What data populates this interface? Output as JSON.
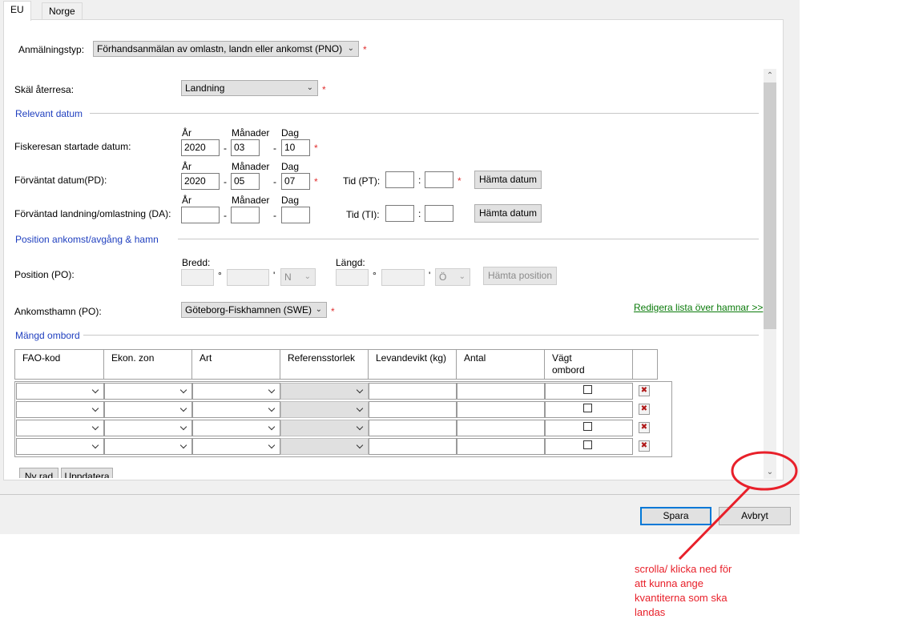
{
  "tabs": [
    {
      "label": "EU"
    },
    {
      "label": "Norge"
    }
  ],
  "notification_type": {
    "label": "Anmälningstyp:",
    "value": "Förhandsanmälan av omlastn, landn eller ankomst (PNO)",
    "required": "*"
  },
  "return_reason": {
    "label": "Skäl återresa:",
    "value": "Landning",
    "required": "*"
  },
  "relevant_date": {
    "title": "Relevant datum"
  },
  "date_headers": {
    "year": "År",
    "month": "Månader",
    "day": "Dag"
  },
  "trip_start": {
    "label": "Fiskeresan startade datum:",
    "year": "2020",
    "month": "03",
    "day": "10",
    "sep": "-",
    "required": "*"
  },
  "expected_date": {
    "label": "Förväntat datum(PD):",
    "year": "2020",
    "month": "05",
    "day": "07",
    "sep": "-",
    "required": "*",
    "time_label": "Tid (PT):",
    "time_sep": ":",
    "time_required": "*",
    "fetch_label": "Hämta datum"
  },
  "expected_landing": {
    "label": "Förväntad landning/omlastning (DA):",
    "year": "",
    "month": "",
    "day": "",
    "sep": "-",
    "time_label": "Tid (TI):",
    "time_sep": ":",
    "fetch_label": "Hämta datum"
  },
  "position_section": {
    "title": "Position ankomst/avgång & hamn"
  },
  "position": {
    "label": "Position (PO):",
    "lat_label": "Bredd:",
    "lon_label": "Längd:",
    "deg": "°",
    "min": "'",
    "lat_dir": "N",
    "lon_dir": "Ö",
    "fetch_label": "Hämta position"
  },
  "port": {
    "label": "Ankomsthamn (PO):",
    "value": "Göteborg-Fiskhamnen (SWE)",
    "required": "*",
    "edit_link": "Redigera lista över hamnar >>"
  },
  "quantity_section": {
    "title": "Mängd ombord"
  },
  "grid": {
    "columns": [
      "FAO-kod",
      "Ekon. zon",
      "Art",
      "Referensstorlek",
      "Levandevikt (kg)",
      "Antal",
      "Vägt ombord"
    ],
    "row_count": 4,
    "delete_icon": "delete-x-icon"
  },
  "grid_buttons": {
    "new_row": "Ny rad",
    "update": "Uppdatera"
  },
  "footer": {
    "save": "Spara",
    "cancel": "Avbryt"
  },
  "annotation": {
    "text_lines": [
      "scrolla/ klicka ned för",
      "att kunna ange",
      "kvantiterna som ska",
      "landas"
    ],
    "color": "#e8202a"
  },
  "colors": {
    "section_title": "#1f3fbf",
    "required": "#e03030",
    "link": "#0a7a0a",
    "default_button_border": "#0078d7"
  }
}
